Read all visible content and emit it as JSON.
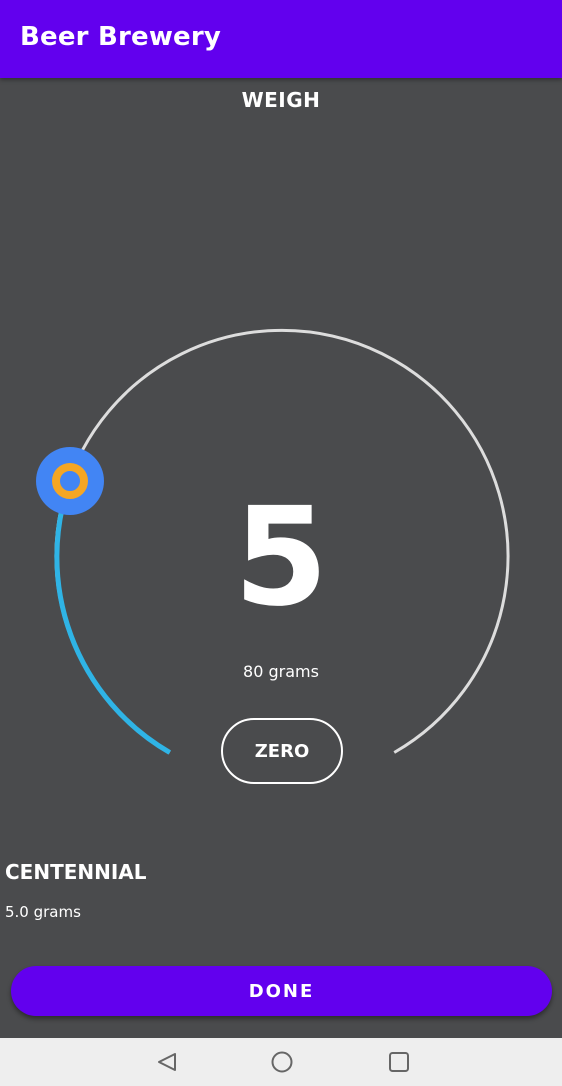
{
  "app": {
    "title": "Beer Brewery"
  },
  "screen": {
    "title": "WEIGH"
  },
  "scale": {
    "value": "5",
    "reading_text": "80 grams",
    "zero_label": "ZERO",
    "progress_fraction": 0.29,
    "track_color": "#dddddd",
    "progress_color": "#2fb4e6",
    "handle_color": "#4285f4",
    "handle_center_color": "#f5a623"
  },
  "ingredient": {
    "name": "CENTENNIAL",
    "amount_text": "5.0 grams"
  },
  "actions": {
    "done_label": "DONE"
  },
  "navigation": {
    "back_icon": "back-triangle-icon",
    "home_icon": "home-circle-icon",
    "recents_icon": "recents-square-icon"
  },
  "colors": {
    "primary": "#6200ee",
    "background": "#4a4b4d",
    "nav_background": "#eeeeee"
  }
}
